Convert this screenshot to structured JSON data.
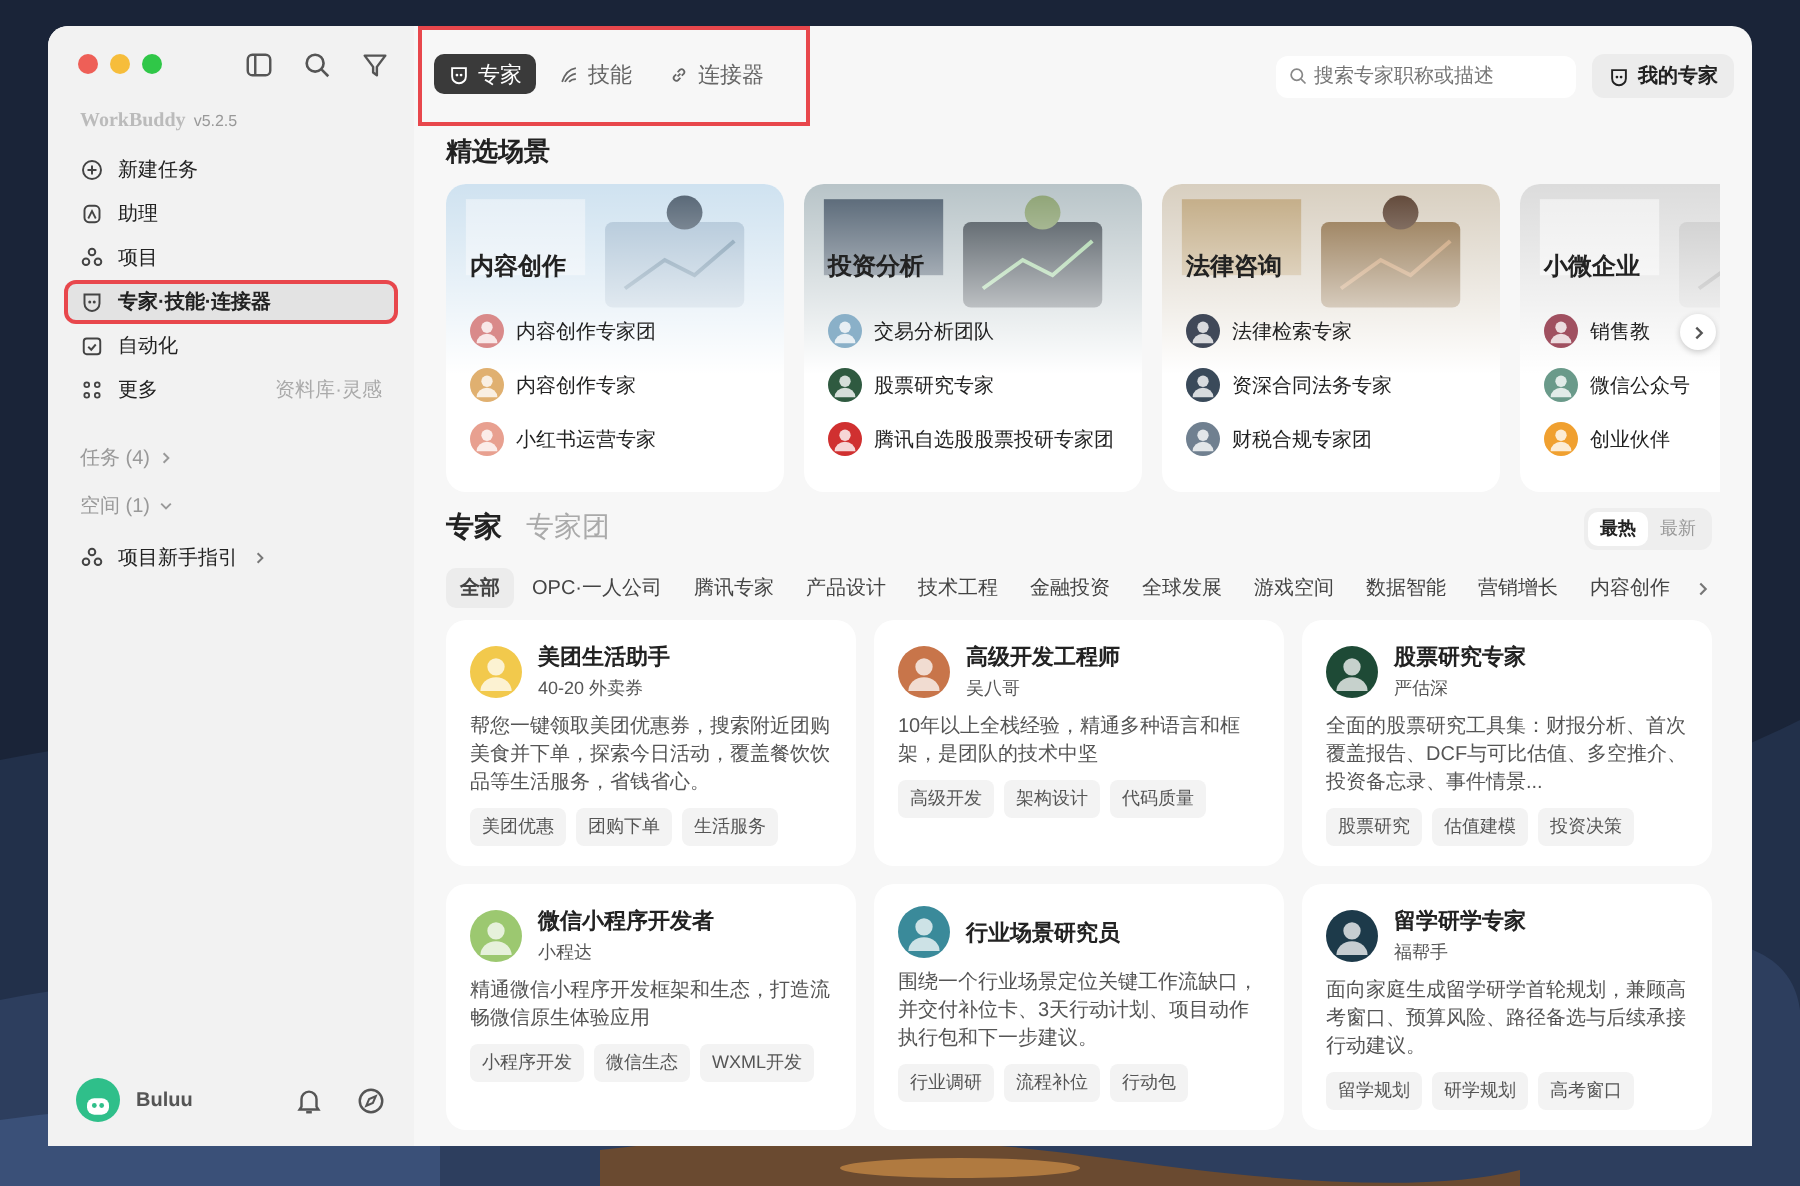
{
  "sidebar": {
    "app_name": "WorkBuddy",
    "version": "v5.2.5",
    "nav": [
      {
        "label": "新建任务",
        "kind": "plus",
        "selected": false,
        "highlighted": false
      },
      {
        "label": "助理",
        "kind": "assistant",
        "selected": false,
        "highlighted": false
      },
      {
        "label": "项目",
        "kind": "project",
        "selected": false,
        "highlighted": false
      },
      {
        "label": "专家·技能·连接器",
        "kind": "expert",
        "selected": true,
        "highlighted": true
      },
      {
        "label": "自动化",
        "kind": "auto",
        "selected": false,
        "highlighted": false
      },
      {
        "label": "更多",
        "kind": "more",
        "selected": false,
        "highlighted": false,
        "hint": "资料库·灵感"
      }
    ],
    "sections": [
      {
        "label": "任务 (4)",
        "expanded": false
      },
      {
        "label": "空间 (1)",
        "expanded": true
      }
    ],
    "guide": {
      "label": "项目新手指引"
    },
    "user": {
      "name": "Buluu"
    }
  },
  "topbar": {
    "tabs_highlighted": true,
    "tabs": [
      {
        "label": "专家",
        "kind": "expert",
        "selected": true
      },
      {
        "label": "技能",
        "kind": "skill",
        "selected": false
      },
      {
        "label": "连接器",
        "kind": "link",
        "selected": false
      }
    ],
    "search": {
      "placeholder": "搜索专家职称或描述"
    },
    "my_button": "我的专家"
  },
  "scenes": {
    "title": "精选场景",
    "cards": [
      {
        "title": "内容创作",
        "items": [
          "内容创作专家团",
          "内容创作专家",
          "小红书运营专家"
        ]
      },
      {
        "title": "投资分析",
        "items": [
          "交易分析团队",
          "股票研究专家",
          "腾讯自选股股票投研专家团"
        ]
      },
      {
        "title": "法律咨询",
        "items": [
          "法律检索专家",
          "资深合同法务专家",
          "财税合规专家团"
        ]
      },
      {
        "title": "小微企业",
        "items": [
          "销售教",
          "微信公众号",
          "创业伙伴"
        ]
      }
    ]
  },
  "experts": {
    "tabs": [
      {
        "label": "专家",
        "selected": true
      },
      {
        "label": "专家团",
        "selected": false
      }
    ],
    "sort": [
      {
        "label": "最热",
        "selected": true
      },
      {
        "label": "最新",
        "selected": false
      }
    ],
    "categories": [
      {
        "label": "全部",
        "selected": true
      },
      {
        "label": "OPC·一人公司",
        "selected": false
      },
      {
        "label": "腾讯专家",
        "selected": false
      },
      {
        "label": "产品设计",
        "selected": false
      },
      {
        "label": "技术工程",
        "selected": false
      },
      {
        "label": "金融投资",
        "selected": false
      },
      {
        "label": "全球发展",
        "selected": false
      },
      {
        "label": "游戏空间",
        "selected": false
      },
      {
        "label": "数据智能",
        "selected": false
      },
      {
        "label": "营销增长",
        "selected": false
      },
      {
        "label": "内容创作",
        "selected": false
      }
    ],
    "cards": [
      {
        "name": "美团生活助手",
        "subtitle": "40-20 外卖券",
        "description": "帮您一键领取美团优惠券，搜索附近团购美食并下单，探索今日活动，覆盖餐饮饮品等生活服务，省钱省心。",
        "tags": [
          "美团优惠",
          "团购下单",
          "生活服务"
        ]
      },
      {
        "name": "高级开发工程师",
        "subtitle": "吴八哥",
        "description": "10年以上全栈经验，精通多种语言和框架，是团队的技术中坚",
        "tags": [
          "高级开发",
          "架构设计",
          "代码质量"
        ]
      },
      {
        "name": "股票研究专家",
        "subtitle": "严估深",
        "description": "全面的股票研究工具集：财报分析、首次覆盖报告、DCF与可比估值、多空推介、投资备忘录、事件情景...",
        "tags": [
          "股票研究",
          "估值建模",
          "投资决策"
        ]
      },
      {
        "name": "微信小程序开发者",
        "subtitle": "小程达",
        "description": "精通微信小程序开发框架和生态，打造流畅微信原生体验应用",
        "tags": [
          "小程序开发",
          "微信生态",
          "WXML开发"
        ]
      },
      {
        "name": "行业场景研究员",
        "description": "围绕一个行业场景定位关键工作流缺口，并交付补位卡、3天行动计划、项目动作执行包和下一步建议。",
        "tags": [
          "行业调研",
          "流程补位",
          "行动包"
        ]
      },
      {
        "name": "留学研学专家",
        "subtitle": "福帮手",
        "description": "面向家庭生成留学研学首轮规划，兼顾高考窗口、预算风险、路径备选与后续承接行动建议。",
        "tags": [
          "留学规划",
          "研学规划",
          "高考窗口"
        ]
      }
    ]
  }
}
